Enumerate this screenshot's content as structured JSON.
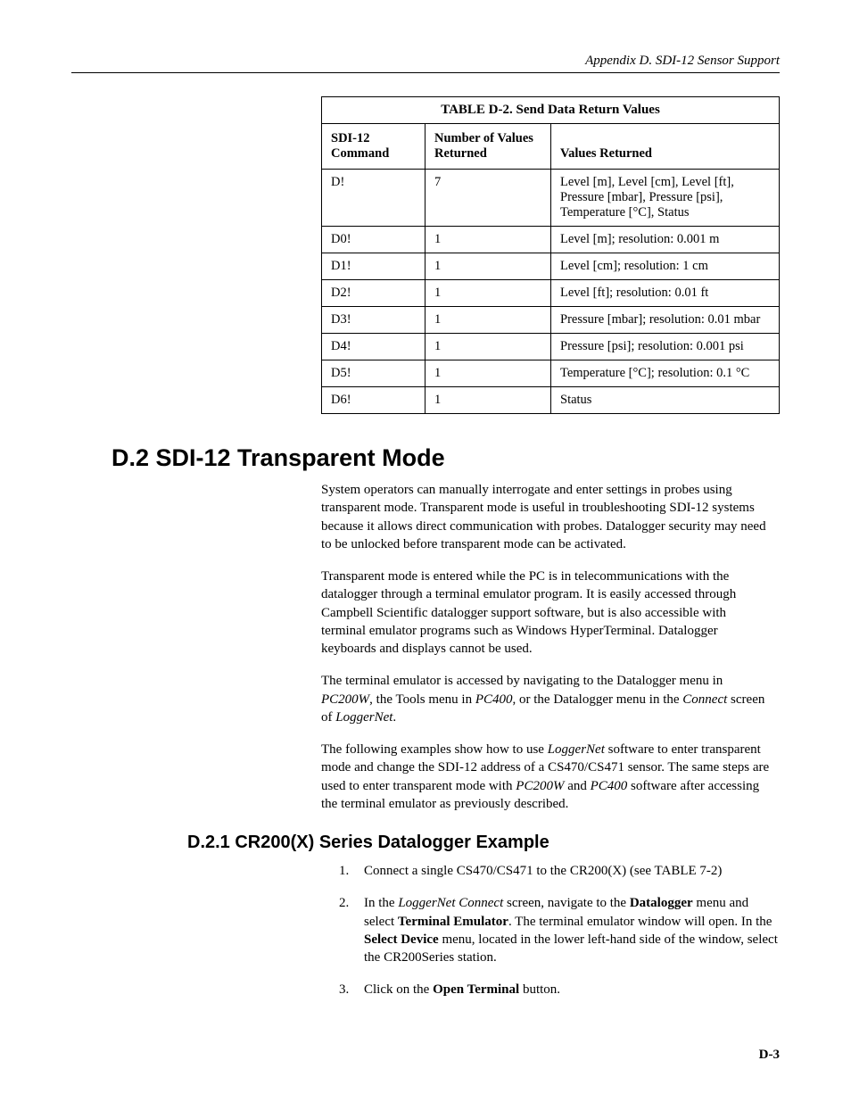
{
  "header": {
    "text": "Appendix D.  SDI-12 Sensor Support"
  },
  "table": {
    "caption": "TABLE D-2.  Send Data Return Values",
    "headers": {
      "cmd": "SDI-12 Command",
      "num": "Number of Values Returned",
      "ret": "Values Returned"
    },
    "rows": [
      {
        "cmd": "D!",
        "num": "7",
        "ret": "Level [m], Level [cm], Level [ft], Pressure [mbar], Pressure [psi], Temperature [°C], Status"
      },
      {
        "cmd": "D0!",
        "num": "1",
        "ret": "Level [m]; resolution: 0.001 m"
      },
      {
        "cmd": "D1!",
        "num": "1",
        "ret": "Level [cm]; resolution: 1 cm"
      },
      {
        "cmd": "D2!",
        "num": "1",
        "ret": "Level [ft]; resolution: 0.01 ft"
      },
      {
        "cmd": "D3!",
        "num": "1",
        "ret": "Pressure [mbar]; resolution: 0.01 mbar"
      },
      {
        "cmd": "D4!",
        "num": "1",
        "ret": "Pressure [psi]; resolution: 0.001 psi"
      },
      {
        "cmd": "D5!",
        "num": "1",
        "ret": "Temperature [°C]; resolution: 0.1 °C"
      },
      {
        "cmd": "D6!",
        "num": "1",
        "ret": "Status"
      }
    ]
  },
  "section": {
    "heading": "D.2  SDI-12 Transparent Mode",
    "p1": "System operators can manually interrogate and enter settings in probes using transparent mode.  Transparent mode is useful in troubleshooting SDI-12 systems because it allows direct communication with probes.  Datalogger security may need to be unlocked before transparent mode can be activated.",
    "p2": "Transparent mode is entered while the PC is in telecommunications with the datalogger through a terminal emulator program.  It is easily accessed through Campbell Scientific datalogger support software, but is also accessible with terminal emulator programs such as Windows HyperTerminal.  Datalogger keyboards and displays cannot be used.",
    "p3_pre": "The terminal emulator is accessed by navigating to the Datalogger menu in ",
    "p3_i1": "PC200W",
    "p3_mid1": ", the Tools menu in ",
    "p3_i2": "PC400",
    "p3_mid2": ", or the Datalogger menu in the ",
    "p3_i3": "Connect",
    "p3_post": " screen of ",
    "p3_i4": "LoggerNet",
    "p3_end": ".",
    "p4_pre": "The following examples show how to use ",
    "p4_i1": "LoggerNet",
    "p4_mid": " software to enter transparent mode and change the SDI-12 address of a CS470/CS471 sensor.  The same steps are used to enter transparent mode with ",
    "p4_i2": "PC200W",
    "p4_and": " and ",
    "p4_i3": "PC400",
    "p4_post": " software after accessing the terminal emulator as previously described."
  },
  "subsection": {
    "heading": "D.2.1   CR200(X) Series Datalogger Example",
    "steps": [
      {
        "n": "1.",
        "parts": [
          {
            "t": "Connect a single CS470/CS471 to the CR200(X) (see TABLE 7-2)"
          }
        ]
      },
      {
        "n": "2.",
        "parts": [
          {
            "t": "In the "
          },
          {
            "i": "LoggerNet Connect"
          },
          {
            "t": " screen, navigate to the "
          },
          {
            "b": "Datalogger"
          },
          {
            "t": " menu and select "
          },
          {
            "b": "Terminal Emulator"
          },
          {
            "t": ".  The terminal emulator window will open.  In the "
          },
          {
            "b": "Select Device"
          },
          {
            "t": " menu, located in the lower left-hand side of the window, select the CR200Series station."
          }
        ]
      },
      {
        "n": "3.",
        "parts": [
          {
            "t": "Click on the "
          },
          {
            "b": "Open Terminal"
          },
          {
            "t": " button."
          }
        ]
      }
    ]
  },
  "footer": {
    "page": "D-3"
  }
}
